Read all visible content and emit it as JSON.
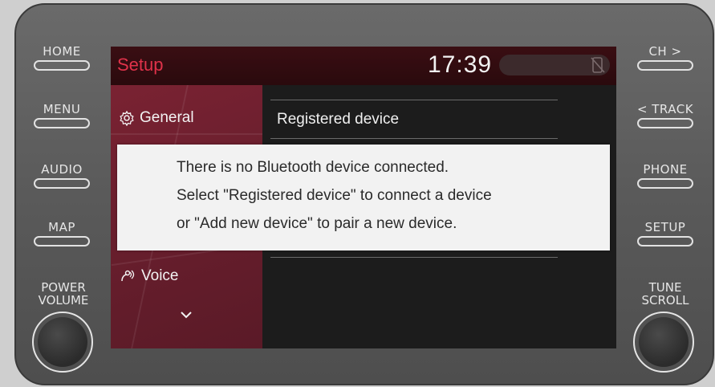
{
  "hardware": {
    "left_buttons": [
      "HOME",
      "MENU",
      "AUDIO",
      "MAP"
    ],
    "right_buttons": [
      "CH >",
      "< TRACK",
      "PHONE",
      "SETUP"
    ],
    "left_knob_label_1": "POWER",
    "left_knob_label_2": "VOLUME",
    "right_knob_label_1": "TUNE",
    "right_knob_label_2": "SCROLL"
  },
  "screen": {
    "title": "Setup",
    "clock": "17:39",
    "sidebar": {
      "items": [
        {
          "label": "General",
          "icon": "gear-icon"
        },
        {
          "label": "Voice",
          "icon": "voice-icon"
        }
      ],
      "more_icon": "chevron-down-icon"
    },
    "main": {
      "items": [
        {
          "label": "Registered device"
        }
      ]
    },
    "dialog": {
      "line1": "There is no Bluetooth device connected.",
      "line2": "Select \"Registered device\" to connect a device",
      "line3": "or \"Add new device\" to pair a new device."
    }
  },
  "colors": {
    "accent": "#e0324a",
    "sidebar_bg": "#6b1f2e",
    "dialog_bg": "#f2f2f2"
  }
}
